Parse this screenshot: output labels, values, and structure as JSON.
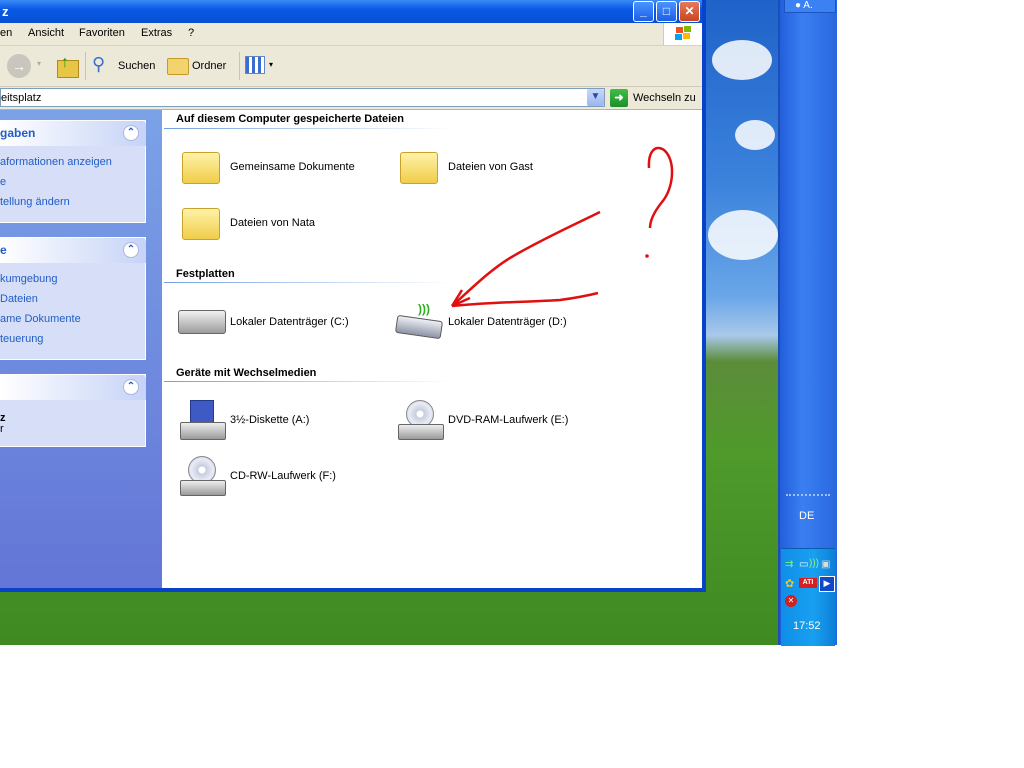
{
  "window": {
    "title": "z"
  },
  "menu": [
    "en",
    "Ansicht",
    "Favoriten",
    "Extras",
    "?"
  ],
  "toolbar": {
    "search_label": "Suchen",
    "folders_label": "Ordner"
  },
  "address": {
    "value": "eitsplatz",
    "go_label": "Wechseln zu"
  },
  "taskpane": {
    "box1": {
      "title": "gaben",
      "links": [
        "aformationen anzeigen",
        "e",
        "tellung ändern"
      ]
    },
    "box2": {
      "title": "e",
      "links": [
        "kumgebung",
        "Dateien",
        "ame Dokumente",
        "teuerung"
      ]
    },
    "box3": {
      "title": "",
      "lines": [
        "z",
        "r"
      ]
    }
  },
  "content": {
    "section_files": "Auf diesem Computer gespeicherte Dateien",
    "files": [
      "Gemeinsame Dokumente",
      "Dateien von Gast",
      "Dateien von Nata"
    ],
    "section_drives": "Festplatten",
    "drives": [
      "Lokaler Datenträger (C:)",
      "Lokaler Datenträger (D:)"
    ],
    "section_removable": "Geräte mit Wechselmedien",
    "removable": [
      "3½-Diskette (A:)",
      "DVD-RAM-Laufwerk (E:)",
      "CD-RW-Laufwerk (F:)"
    ]
  },
  "taskbar": {
    "user": "A.",
    "language": "DE",
    "clock": "17:52"
  },
  "colors": {
    "title_blue": "#0a58e6",
    "link_blue": "#215dc6",
    "annotation_red": "#e01010"
  }
}
